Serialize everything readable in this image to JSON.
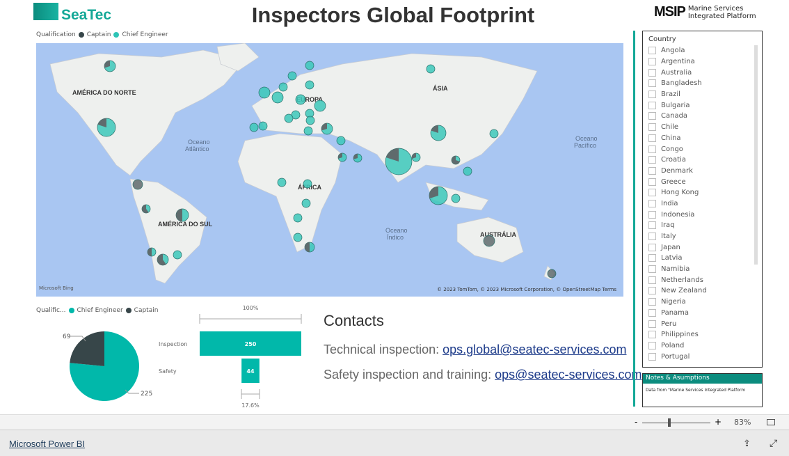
{
  "header": {
    "logo_text": "SeaTec",
    "title": "Inspectors Global Footprint",
    "msip_abbr": "MSIP",
    "msip_line1": "Marine Services",
    "msip_line2": "Integrated Platform"
  },
  "map": {
    "legend_title": "Qualification",
    "legend_items": [
      {
        "label": "Captain",
        "color": "#374649"
      },
      {
        "label": "Chief Engineer",
        "color": "#2ec4b6"
      }
    ],
    "labels": {
      "na": "AMÉRICA DO NORTE",
      "sa": "AMÉRICA DO SUL",
      "eu": "EUROPA",
      "as": "ÁSIA",
      "af": "ÁFRICA",
      "au": "AUSTRÁLIA",
      "atl1": "Oceano",
      "atl2": "Atlântico",
      "pac1": "Oceano",
      "pac2": "Pacífico",
      "ind1": "Oceano",
      "ind2": "Índico"
    },
    "bing": "Microsoft Bing",
    "attribution": "© 2023 TomTom, © 2023 Microsoft Corporation, © OpenStreetMap  Terms"
  },
  "pie": {
    "legend_title": "Qualific...",
    "legend_items": [
      {
        "label": "Chief Engineer",
        "color": "#01b8aa"
      },
      {
        "label": "Captain",
        "color": "#374649"
      }
    ],
    "chart_data": {
      "type": "pie",
      "categories": [
        "Chief Engineer",
        "Captain"
      ],
      "values": [
        225,
        69
      ]
    },
    "label_captain": "69",
    "label_chief": "225"
  },
  "funnel": {
    "top_label": "100%",
    "bottom_label": "17.6%",
    "chart_data": {
      "type": "bar",
      "categories": [
        "Inspection",
        "Safety"
      ],
      "values": [
        250,
        44
      ]
    },
    "cat0": "Inspection",
    "cat1": "Safety",
    "val0": "250",
    "val1": "44"
  },
  "contacts": {
    "title": "Contacts",
    "tech_label": "Technical inspection: ",
    "tech_email": "ops.global@seatec-services.com",
    "safety_label": "Safety inspection and training: ",
    "safety_email": "ops@seatec-services.com"
  },
  "slicer": {
    "title": "Country",
    "items": [
      "Angola",
      "Argentina",
      "Australia",
      "Bangladesh",
      "Brazil",
      "Bulgaria",
      "Canada",
      "Chile",
      "China",
      "Congo",
      "Croatia",
      "Denmark",
      "Greece",
      "Hong Kong",
      "India",
      "Indonesia",
      "Iraq",
      "Italy",
      "Japan",
      "Latvia",
      "Namibia",
      "Netherlands",
      "New Zealand",
      "Nigeria",
      "Panama",
      "Peru",
      "Philippines",
      "Poland",
      "Portugal"
    ]
  },
  "notes": {
    "title": "Notes & Asumptions",
    "body": "Data from \"Marine Services Integrated Platform"
  },
  "footer": {
    "zoom_minus": "-",
    "zoom_plus": "+",
    "zoom": "83%",
    "powerbi": "Microsoft Power BI"
  }
}
